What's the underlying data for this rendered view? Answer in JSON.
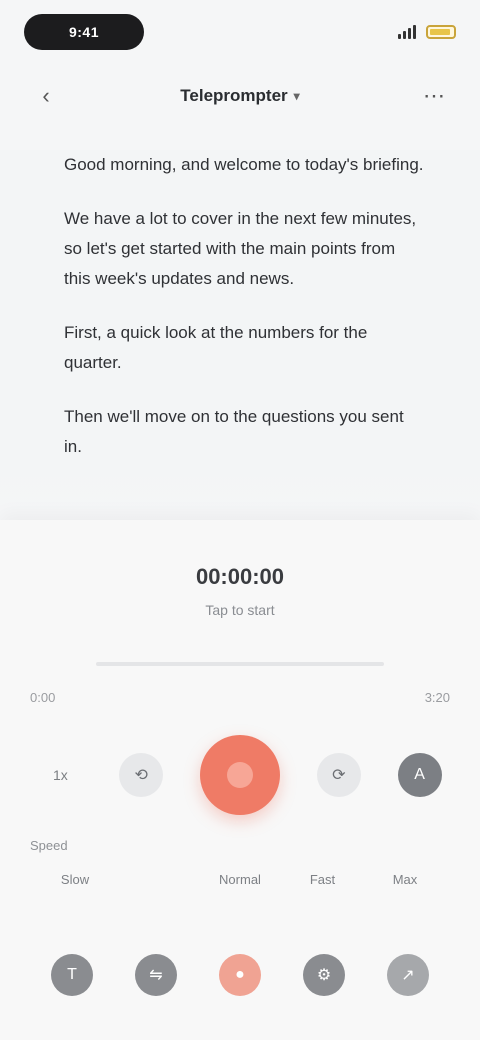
{
  "status_bar": {
    "time": "9:41"
  },
  "nav": {
    "back_icon": "chevron-left-icon",
    "title": "Teleprompter",
    "menu_icon": "more-icon"
  },
  "script": {
    "paragraphs": [
      "Good morning, and welcome to today's briefing.",
      "We have a lot to cover in the next few minutes, so let's get started with the main points from this week's updates and news.",
      "First, a quick look at the numbers for the quarter.",
      "Then we'll move on to the questions you sent in."
    ]
  },
  "timer": {
    "value": "00:00:00",
    "subtitle": "Tap to start"
  },
  "progress": {
    "fraction": 0.0,
    "start_label": "0:00",
    "end_label": "3:20"
  },
  "controls": {
    "left_small": "1x",
    "right_small": "A",
    "record_icon": "record-icon"
  },
  "speed": {
    "label": "Speed",
    "options": [
      "Slow",
      "",
      "Normal",
      "Fast",
      "Max"
    ]
  },
  "tabs": [
    {
      "icon": "text-icon",
      "glyph": "T"
    },
    {
      "icon": "mirror-icon",
      "glyph": "⇋"
    },
    {
      "icon": "camera-icon",
      "glyph": "●"
    },
    {
      "icon": "settings-icon",
      "glyph": "⚙"
    },
    {
      "icon": "share-icon",
      "glyph": "↗"
    }
  ],
  "colors": {
    "accent": "#ef7b66",
    "accent_light": "#f0a393",
    "battery": "#e8c548"
  }
}
